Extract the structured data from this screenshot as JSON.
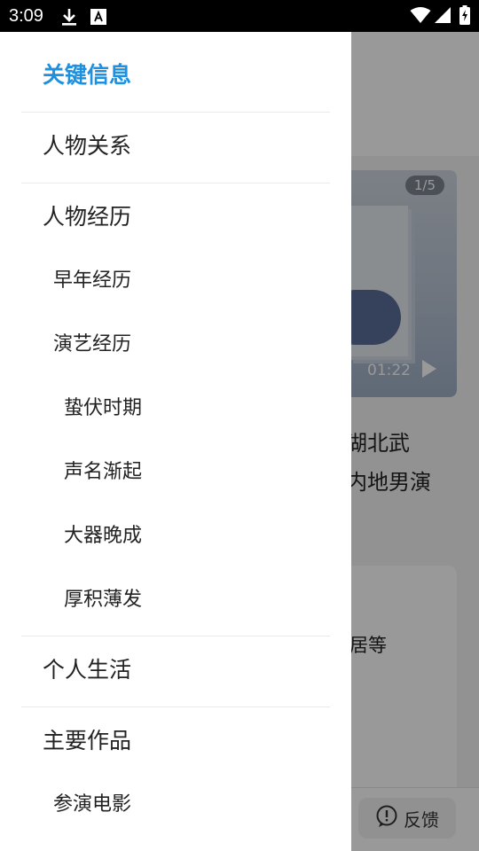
{
  "status_bar": {
    "time": "3:09"
  },
  "background_page": {
    "media_counter": "1/5",
    "media_duration": "01:22",
    "text_line_1": "湖北武",
    "text_line_2": "内地男演",
    "card_text": "居等",
    "feedback_label": "反馈"
  },
  "drawer": {
    "title": "关键信息",
    "items": [
      {
        "label": "人物关系",
        "level": 1
      },
      {
        "label": "人物经历",
        "level": 1
      },
      {
        "label": "早年经历",
        "level": 2
      },
      {
        "label": "演艺经历",
        "level": 2
      },
      {
        "label": "蛰伏时期",
        "level": 3
      },
      {
        "label": "声名渐起",
        "level": 3
      },
      {
        "label": "大器晚成",
        "level": 3
      },
      {
        "label": "厚积薄发",
        "level": 3
      },
      {
        "label": "个人生活",
        "level": 1
      },
      {
        "label": "主要作品",
        "level": 1
      },
      {
        "label": "参演电影",
        "level": 2
      }
    ]
  },
  "icons": {
    "status_left": [
      "download-icon",
      "font-icon"
    ],
    "status_right": [
      "wifi-icon",
      "signal-icon",
      "battery-charging-icon"
    ],
    "feedback": "exclamation-circle-icon",
    "media": "play-icon"
  },
  "colors": {
    "accent": "#1e90e0",
    "status_bar": "#000000",
    "scrim": "rgba(0,0,0,0.4)"
  }
}
